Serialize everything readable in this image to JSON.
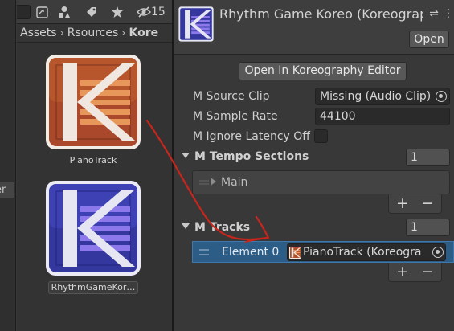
{
  "project": {
    "toolbar": {
      "hidden_count": "15"
    },
    "breadcrumb": [
      "Assets",
      "Rsources",
      "Kore"
    ],
    "assets": [
      {
        "name": "PianoTrack",
        "color": "#b5512a"
      },
      {
        "name": "RhythmGameKor…",
        "color": "#3a3fae"
      }
    ]
  },
  "left_tab": {
    "label": "er"
  },
  "inspector": {
    "title": "Rhythm Game Koreo (Koreograp",
    "open_button": "Open",
    "open_editor_button": "Open In Koreography Editor",
    "properties": [
      {
        "label": "M Source Clip",
        "value": "Missing (Audio Clip)"
      },
      {
        "label": "M Sample Rate",
        "value": "44100"
      },
      {
        "label": "M Ignore Latency Off",
        "value": ""
      }
    ],
    "tempo_sections": {
      "label": "M Tempo Sections",
      "size": "1",
      "items": [
        "Main"
      ]
    },
    "tracks": {
      "label": "M Tracks",
      "size": "1",
      "element_label": "Element 0",
      "element_value": "PianoTrack (Koreogra"
    },
    "plus": "+",
    "minus": "−"
  },
  "colors": {
    "accent_annotation": "#c8251c",
    "selection": "#2c5d87"
  },
  "icons": [
    "scene-icon",
    "shapes-icon",
    "tag-icon",
    "star-icon",
    "eye-slash-icon",
    "sliders-icon",
    "more-icon",
    "object-picker-icon"
  ]
}
